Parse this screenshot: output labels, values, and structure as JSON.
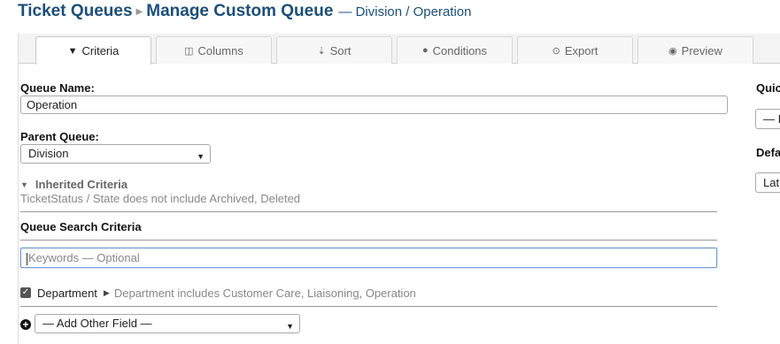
{
  "header": {
    "title": "Ticket Queues",
    "page_title": "Manage Custom Queue",
    "subtitle": "— Division / Operation"
  },
  "tabs": [
    {
      "label": "Criteria",
      "icon": "filter-icon",
      "glyph": "▼",
      "active": true
    },
    {
      "label": "Columns",
      "icon": "columns-icon",
      "glyph": "◫",
      "active": false
    },
    {
      "label": "Sort",
      "icon": "sort-icon",
      "glyph": "⇣",
      "active": false
    },
    {
      "label": "Conditions",
      "icon": "exclamation-circle-icon",
      "glyph": "●",
      "active": false
    },
    {
      "label": "Export",
      "icon": "download-circle-icon",
      "glyph": "⊙",
      "active": false
    },
    {
      "label": "Preview",
      "icon": "eye-icon",
      "glyph": "◉",
      "active": false
    }
  ],
  "form": {
    "queue_name_label": "Queue Name:",
    "queue_name_value": "Operation",
    "parent_queue_label": "Parent Queue:",
    "parent_queue_value": "Division",
    "inherited_title": "Inherited Criteria",
    "inherited_text": "TicketStatus / State does not include Archived, Deleted",
    "search_criteria_label": "Queue Search Criteria",
    "keywords_placeholder": "Keywords — Optional",
    "department": {
      "checked": true,
      "label": "Department",
      "description": "Department includes Customer Care, Liaisoning, Operation"
    },
    "add_other_field_value": "— Add Other Field —"
  },
  "side": {
    "quick_label": "Quic",
    "quick_value": "— I",
    "default_label": "Defa",
    "default_value": "Lat"
  },
  "colors": {
    "title": "#1b4f7a",
    "focus_border": "#6f9ad1",
    "muted_text": "#888888"
  }
}
